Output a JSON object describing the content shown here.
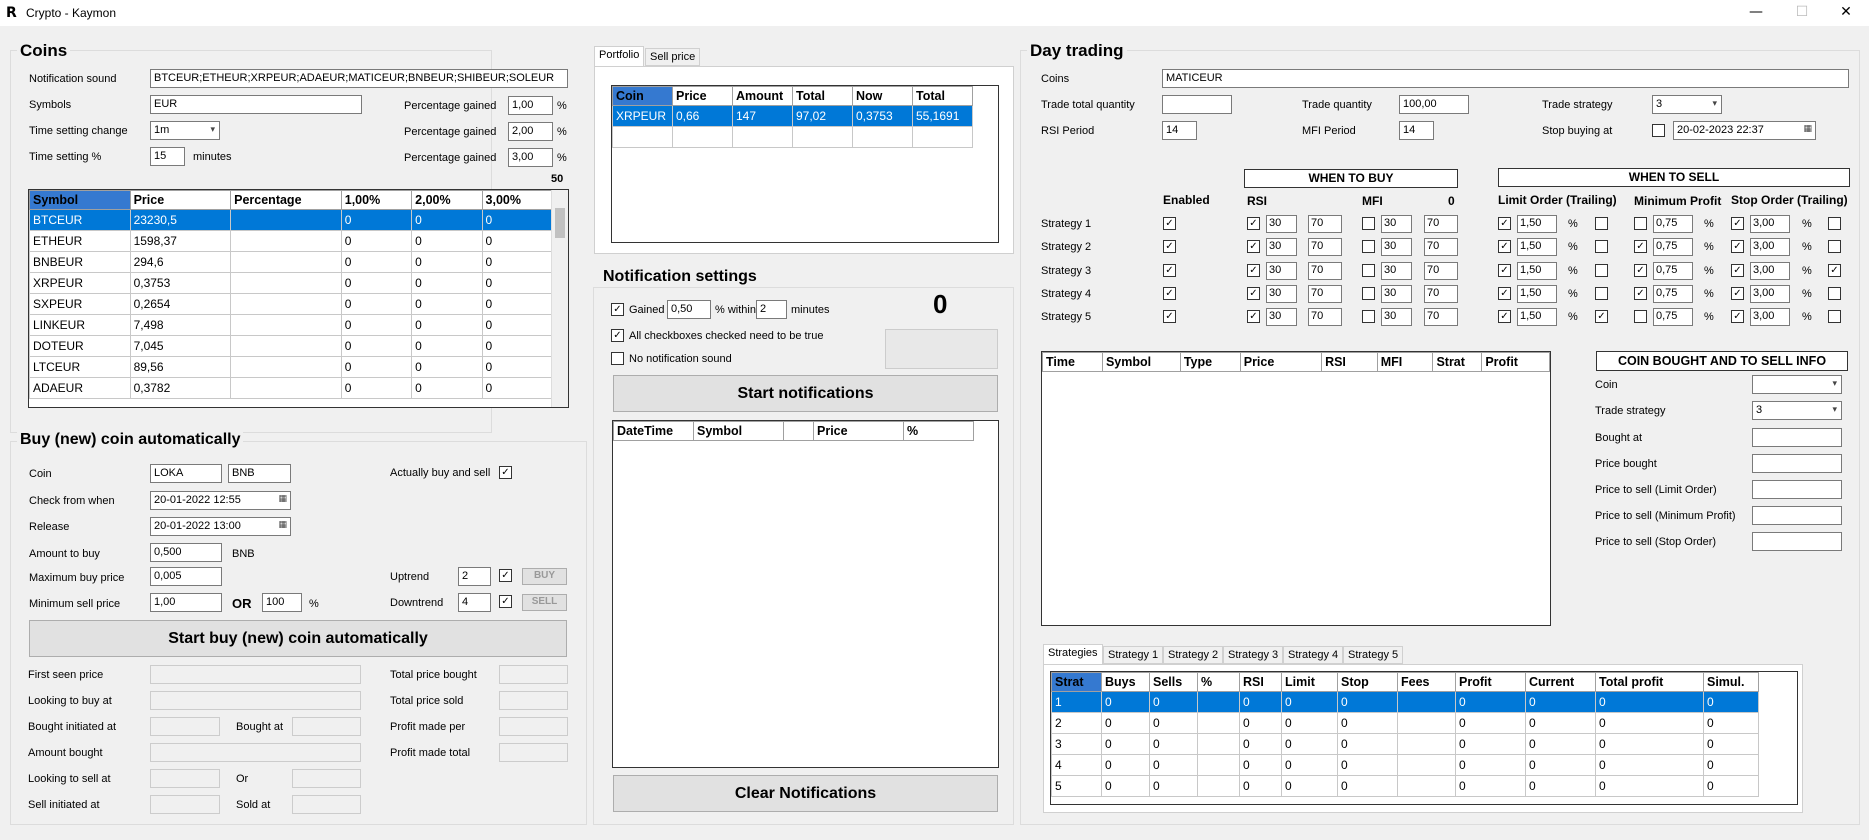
{
  "window": {
    "title": "Crypto - Kaymon",
    "minimize": "—",
    "maximize": "☐",
    "close": "✕"
  },
  "coins": {
    "title": "Coins",
    "notification_sound_label": "Notification sound",
    "notification_sound_value": "BTCEUR;ETHEUR;XRPEUR;ADAEUR;MATICEUR;BNBEUR;SHIBEUR;SOLEUR",
    "symbols_label": "Symbols",
    "symbols_value": "EUR",
    "time_change_label": "Time setting change",
    "time_change_value": "1m",
    "time_pct_label": "Time setting %",
    "time_pct_value": "15",
    "minutes": "minutes",
    "pct_label": "Percentage gained",
    "pct1": "1,00",
    "pct2": "2,00",
    "pct3": "3,00",
    "pct_unit": "%",
    "count": "50",
    "columns": [
      "Symbol",
      "Price",
      "Percentage",
      "1,00%",
      "2,00%",
      "3,00%"
    ],
    "rows": [
      [
        "BTCEUR",
        "23230,5",
        "",
        "0",
        "0",
        "0"
      ],
      [
        "ETHEUR",
        "1598,37",
        "",
        "0",
        "0",
        "0"
      ],
      [
        "BNBEUR",
        "294,6",
        "",
        "0",
        "0",
        "0"
      ],
      [
        "XRPEUR",
        "0,3753",
        "",
        "0",
        "0",
        "0"
      ],
      [
        "SXPEUR",
        "0,2654",
        "",
        "0",
        "0",
        "0"
      ],
      [
        "LINKEUR",
        "7,498",
        "",
        "0",
        "0",
        "0"
      ],
      [
        "DOTEUR",
        "7,045",
        "",
        "0",
        "0",
        "0"
      ],
      [
        "LTCEUR",
        "89,56",
        "",
        "0",
        "0",
        "0"
      ],
      [
        "ADAEUR",
        "0,3782",
        "",
        "0",
        "0",
        "0"
      ]
    ]
  },
  "buy": {
    "title": "Buy (new) coin automatically",
    "coin_label": "Coin",
    "coin_value": "LOKA",
    "coin_pair": "BNB",
    "actually_label": "Actually buy and sell",
    "check_label": "Check from when",
    "check_value": "20-01-2022 12:55",
    "release_label": "Release",
    "release_value": "20-01-2022 13:00",
    "amount_label": "Amount to buy",
    "amount_value": "0,500",
    "amount_unit": "BNB",
    "max_label": "Maximum buy price",
    "max_value": "0,005",
    "min_label": "Minimum sell price",
    "min_value": "1,00",
    "or": "OR",
    "min_pct": "100",
    "pct": "%",
    "uptrend_label": "Uptrend",
    "uptrend_value": "2",
    "buy_btn": "BUY",
    "downtrend_label": "Downtrend",
    "downtrend_value": "4",
    "sell_btn": "SELL",
    "start_btn": "Start buy (new) coin automatically",
    "first_seen": "First seen price",
    "looking_buy": "Looking to buy at",
    "bought_init": "Bought initiated at",
    "bought_at": "Bought at",
    "amount_bought": "Amount bought",
    "looking_sell": "Looking to sell at",
    "or2": "Or",
    "sell_init": "Sell initiated at",
    "sold_at": "Sold at",
    "total_bought": "Total price bought",
    "total_sold": "Total price sold",
    "profit_per": "Profit made per",
    "profit_total": "Profit made total"
  },
  "portfolio": {
    "tabs": [
      "Portfolio",
      "Sell price"
    ],
    "columns": [
      "Coin",
      "Price",
      "Amount",
      "Total",
      "Now",
      "Total"
    ],
    "rows": [
      [
        "XRPEUR",
        "0,66",
        "147",
        "97,02",
        "0,3753",
        "55,1691"
      ]
    ]
  },
  "notif": {
    "title": "Notification settings",
    "gained": "Gained",
    "gained_value": "0,50",
    "within": "% within",
    "within_value": "2",
    "minutes": "minutes",
    "all_cb": "All checkboxes checked need to be true",
    "no_sound": "No notification sound",
    "count": "0",
    "start_btn": "Start notifications",
    "columns": [
      "DateTime",
      "Symbol",
      "",
      "Price",
      "%"
    ],
    "clear_btn": "Clear Notifications"
  },
  "day": {
    "title": "Day trading",
    "coins_label": "Coins",
    "coins_value": "MATICEUR",
    "ttq_label": "Trade total quantity",
    "ttq_value": "",
    "tq_label": "Trade quantity",
    "tq_value": "100,00",
    "ts_label": "Trade strategy",
    "ts_value": "3",
    "rsi_label": "RSI Period",
    "rsi_value": "14",
    "mfi_label": "MFI Period",
    "mfi_value": "14",
    "stop_label": "Stop buying at",
    "stop_value": "20-02-2023 22:37",
    "when_buy": "WHEN TO BUY",
    "when_sell": "WHEN TO SELL",
    "enabled": "Enabled",
    "rsi": "RSI",
    "mfi": "MFI",
    "zero": "0",
    "limit": "Limit Order (Trailing)",
    "minprofit": "Minimum Profit",
    "stop": "Stop Order (Trailing)",
    "strategies": [
      {
        "name": "Strategy 1",
        "rsi_lo": "30",
        "rsi_hi": "70",
        "mfi_lo": "30",
        "mfi_hi": "70",
        "limit": "1,50",
        "minp": "0,75",
        "stop": "3,00"
      },
      {
        "name": "Strategy 2",
        "rsi_lo": "30",
        "rsi_hi": "70",
        "mfi_lo": "30",
        "mfi_hi": "70",
        "limit": "1,50",
        "minp": "0,75",
        "stop": "3,00"
      },
      {
        "name": "Strategy 3",
        "rsi_lo": "30",
        "rsi_hi": "70",
        "mfi_lo": "30",
        "mfi_hi": "70",
        "limit": "1,50",
        "minp": "0,75",
        "stop": "3,00"
      },
      {
        "name": "Strategy 4",
        "rsi_lo": "30",
        "rsi_hi": "70",
        "mfi_lo": "30",
        "mfi_hi": "70",
        "limit": "1,50",
        "minp": "0,75",
        "stop": "3,00"
      },
      {
        "name": "Strategy 5",
        "rsi_lo": "30",
        "rsi_hi": "70",
        "mfi_lo": "30",
        "mfi_hi": "70",
        "limit": "1,50",
        "minp": "0,75",
        "stop": "3,00"
      }
    ],
    "trade_columns": [
      "Time",
      "Symbol",
      "Type",
      "Price",
      "RSI",
      "MFI",
      "Strat",
      "Profit"
    ],
    "info_title": "COIN BOUGHT AND TO SELL INFO",
    "info_coin": "Coin",
    "info_ts": "Trade strategy",
    "info_ts_value": "3",
    "info_bought_at": "Bought at",
    "info_price_bought": "Price bought",
    "info_limit": "Price to sell (Limit Order)",
    "info_minp": "Price to sell (Minimum Profit)",
    "info_stop": "Price to sell (Stop Order)",
    "strat_tabs": [
      "Strategies",
      "Strategy 1",
      "Strategy 2",
      "Strategy 3",
      "Strategy 4",
      "Strategy 5"
    ],
    "strat_columns": [
      "Strat",
      "Buys",
      "Sells",
      "%",
      "RSI",
      "Limit",
      "Stop",
      "Fees",
      "Profit",
      "Current",
      "Total profit",
      "Simul."
    ],
    "strat_rows": [
      [
        "1",
        "0",
        "0",
        "",
        "0",
        "0",
        "0",
        "",
        "0",
        "0",
        "0",
        "0"
      ],
      [
        "2",
        "0",
        "0",
        "",
        "0",
        "0",
        "0",
        "",
        "0",
        "0",
        "0",
        "0"
      ],
      [
        "3",
        "0",
        "0",
        "",
        "0",
        "0",
        "0",
        "",
        "0",
        "0",
        "0",
        "0"
      ],
      [
        "4",
        "0",
        "0",
        "",
        "0",
        "0",
        "0",
        "",
        "0",
        "0",
        "0",
        "0"
      ],
      [
        "5",
        "0",
        "0",
        "",
        "0",
        "0",
        "0",
        "",
        "0",
        "0",
        "0",
        "0"
      ]
    ]
  },
  "icons": {
    "checkmark": "✓",
    "spin_up": "▲",
    "spin_down": "▼",
    "dropdown": "▾",
    "calendar": "▦"
  }
}
